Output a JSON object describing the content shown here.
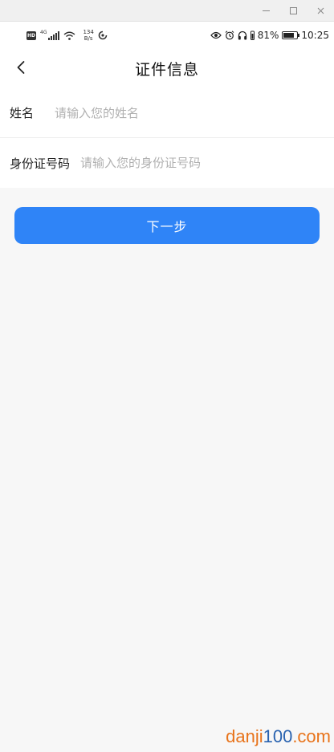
{
  "window": {
    "controls": [
      "minimize-icon",
      "maximize-icon",
      "close-icon"
    ]
  },
  "status_bar": {
    "hd_badge": "HD",
    "network_gen": "4G",
    "speed_value": "134",
    "speed_unit": "B/s",
    "battery_percent_text": "81%",
    "battery_level": 0.81,
    "time": "10:25",
    "icons": [
      "signal-icon",
      "wifi-icon",
      "sync-icon",
      "eye-icon",
      "alarm-icon",
      "headphones-icon",
      "battery-icon"
    ]
  },
  "header": {
    "title": "证件信息",
    "back_icon": "chevron-left-icon"
  },
  "form": {
    "name_label": "姓名",
    "name_placeholder": "请输入您的姓名",
    "name_value": "",
    "id_label": "身份证号码",
    "id_placeholder": "请输入您的身份证号码",
    "id_value": ""
  },
  "actions": {
    "next_label": "下一步"
  },
  "watermark": {
    "part1": "danji",
    "part2": "100",
    "part3": ".com"
  },
  "colors": {
    "primary": "#2f84f7",
    "background": "#f7f7f7",
    "placeholder": "#b0b0b0"
  }
}
